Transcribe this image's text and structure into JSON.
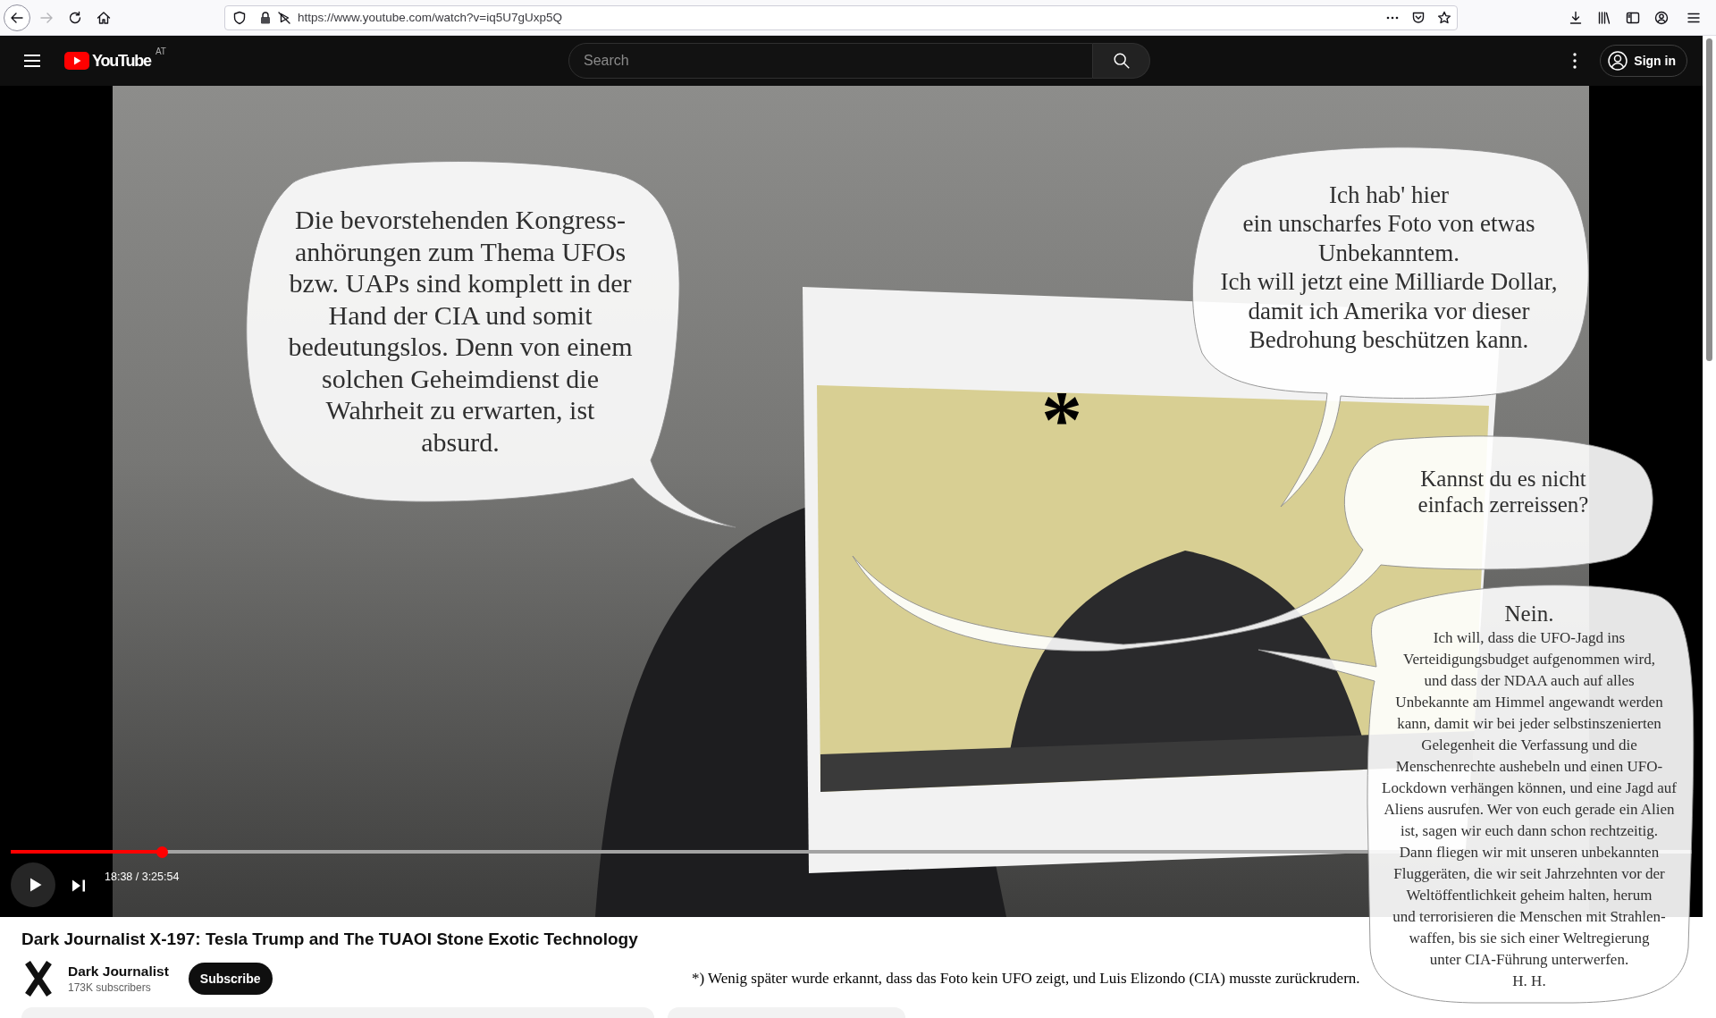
{
  "browser": {
    "nav_buttons": [
      {
        "kind": "back",
        "disabled": false
      },
      {
        "kind": "forward",
        "disabled": true
      },
      {
        "kind": "reload",
        "disabled": false
      },
      {
        "kind": "home",
        "disabled": false
      }
    ],
    "url": "https://www.youtube.com/watch?v=iq5U7gUxp5Q"
  },
  "header": {
    "logo": "YouTube",
    "country_code": "AT",
    "search": {
      "placeholder": "Search"
    },
    "sign_in": "Sign in"
  },
  "player": {
    "progress": {
      "level": 0.09
    },
    "time": "18:38 / 3:25:54"
  },
  "speech_bubbles": [
    {
      "text": "Die bevorstehenden Kongress-\nanhörungen zum Thema UFOs\nbzw. UAPs sind komplett in der\nHand der CIA und somit\nbedeutungslos. Denn von einem\nsolchen Geheimdienst die\nWahrheit zu erwarten, ist\nabsurd."
    },
    {
      "text": "Ich hab' hier\nein unscharfes Foto von etwas\nUnbekanntem.\nIch will jetzt eine Milliarde Dollar,\ndamit ich Amerika vor dieser\nBedrohung beschützen kann."
    },
    {
      "text": "Kannst du es nicht\neinfach zerreissen?"
    },
    {
      "heading": "Nein.",
      "paragraphs": [
        "Ich will, dass die UFO-Jagd ins\nVerteidigungsbudget aufgenommen wird,\nund dass der NDAA auch auf alles\nUnbekannte am Himmel angewandt werden\nkann, damit wir bei jeder selbstinszenierten\nGelegenheit die Verfassung und die\nMenschenrechte aushebeln und einen UFO-\nLockdown verhängen können, und eine Jagd auf\nAliens ausrufen. Wer von euch gerade ein Alien\nist, sagen wir euch dann schon rechtzeitig.",
        "Dann fliegen wir mit unseren unbekannten\nFluggeräten, die wir seit Jahrzehnten vor der\nWeltöffentlichkeit geheim halten, herum\nund terrorisieren die Menschen mit Strahlen-\nwaffen, bis sie sich einer Weltregierung\nunter CIA-Führung unterwerfen."
      ],
      "signature": "H. H."
    }
  ],
  "asterisk": "*",
  "video": {
    "title": "Dark Journalist X-197: Tesla Trump and The TUAOI Stone Exotic Technology",
    "channel": {
      "name": "Dark Journalist",
      "subscribers": "173K subscribers"
    },
    "subscribe": "Subscribe"
  },
  "footnote": "*) Wenig später wurde erkannt, dass das Foto kein UFO zeigt, und Luis Elizondo (CIA) musste zurückrudern."
}
